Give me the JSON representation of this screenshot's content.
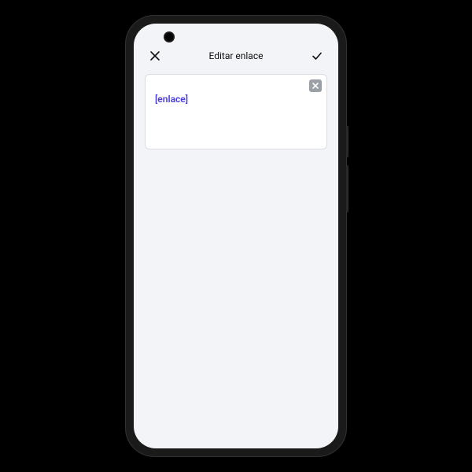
{
  "header": {
    "title": "Editar enlace",
    "close_label": "close",
    "confirm_label": "confirm"
  },
  "editor": {
    "link_text": "[enlace]",
    "clear_label": "clear"
  }
}
